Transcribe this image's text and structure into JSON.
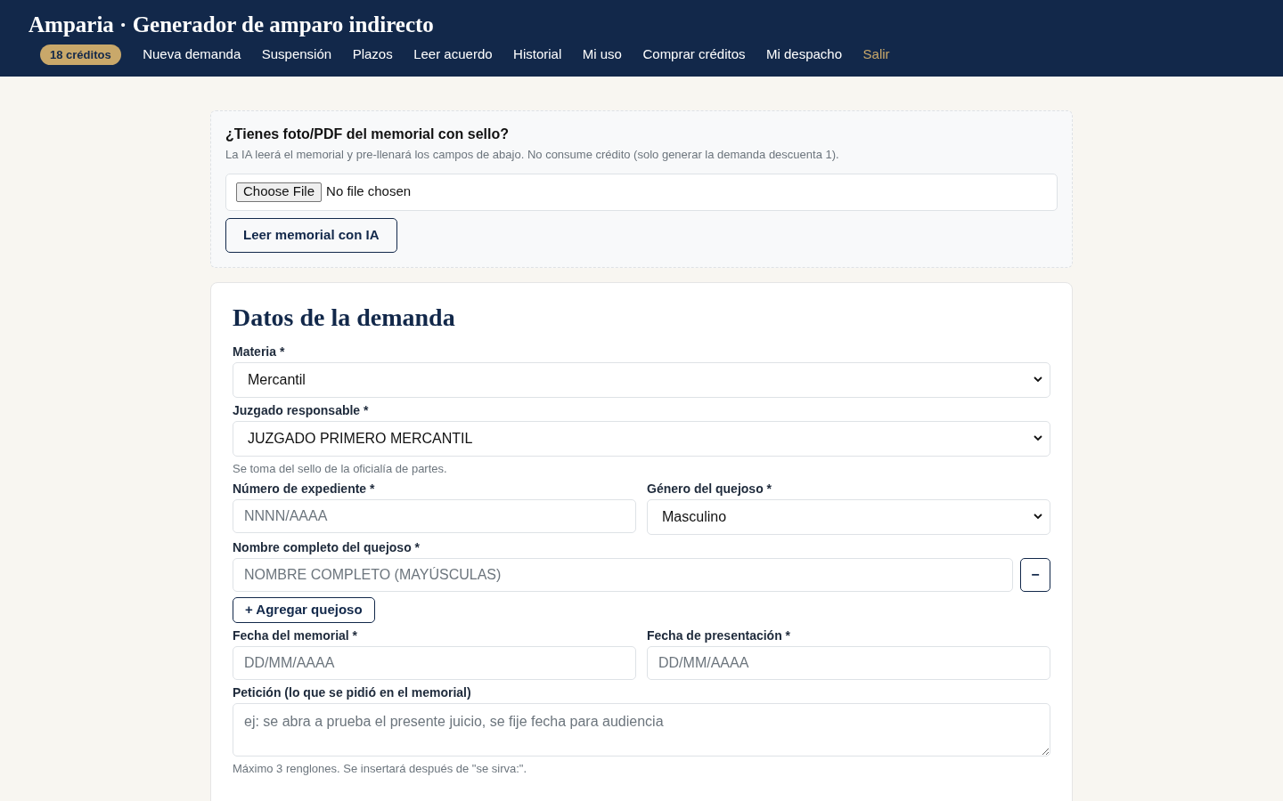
{
  "header": {
    "title": "Amparia · Generador de amparo indirecto",
    "credits_badge": "18 créditos",
    "nav": [
      {
        "label": "Nueva demanda",
        "kind": "link"
      },
      {
        "label": "Suspensión",
        "kind": "link"
      },
      {
        "label": "Plazos",
        "kind": "link"
      },
      {
        "label": "Leer acuerdo",
        "kind": "link"
      },
      {
        "label": "Historial",
        "kind": "link"
      },
      {
        "label": "Mi uso",
        "kind": "link"
      },
      {
        "label": "Comprar créditos",
        "kind": "link"
      },
      {
        "label": "Mi despacho",
        "kind": "link"
      },
      {
        "label": "Salir",
        "kind": "logout"
      }
    ]
  },
  "upload": {
    "title": "¿Tienes foto/PDF del memorial con sello?",
    "description": "La IA leerá el memorial y pre-llenará los campos de abajo. No consume crédito (solo generar la demanda descuenta 1).",
    "file_button": "Choose File",
    "file_status": "No file chosen",
    "action": "Leer memorial con IA"
  },
  "form": {
    "title": "Datos de la demanda",
    "rows": [
      {
        "fields": [
          {
            "kind": "select",
            "label": "Materia *",
            "value": "Mercantil"
          }
        ]
      },
      {
        "fields": [
          {
            "kind": "select",
            "label": "Juzgado responsable *",
            "value": "JUZGADO PRIMERO MERCANTIL",
            "help": "Se toma del sello de la oficialía de partes."
          }
        ]
      },
      {
        "fields": [
          {
            "kind": "input",
            "label": "Número de expediente *",
            "placeholder": "NNNN/AAAA"
          },
          {
            "kind": "select",
            "label": "Género del quejoso *",
            "value": "Masculino"
          }
        ]
      },
      {
        "fields": [
          {
            "kind": "removable",
            "label": "Nombre completo del quejoso *",
            "placeholder": "NOMBRE COMPLETO (MAYÚSCULAS)",
            "remove": "−",
            "add": "+ Agregar quejoso"
          }
        ]
      },
      {
        "fields": [
          {
            "kind": "input",
            "label": "Fecha del memorial *",
            "placeholder": "DD/MM/AAAA"
          },
          {
            "kind": "input",
            "label": "Fecha de presentación *",
            "placeholder": "DD/MM/AAAA"
          }
        ]
      },
      {
        "fields": [
          {
            "kind": "textarea",
            "label": "Petición (lo que se pidió en el memorial)",
            "placeholder": "ej: se abra a prueba el presente juicio, se fije fecha para audiencia",
            "help": "Máximo 3 renglones. Se insertará después de \"se sirva:\"."
          }
        ]
      }
    ]
  }
}
